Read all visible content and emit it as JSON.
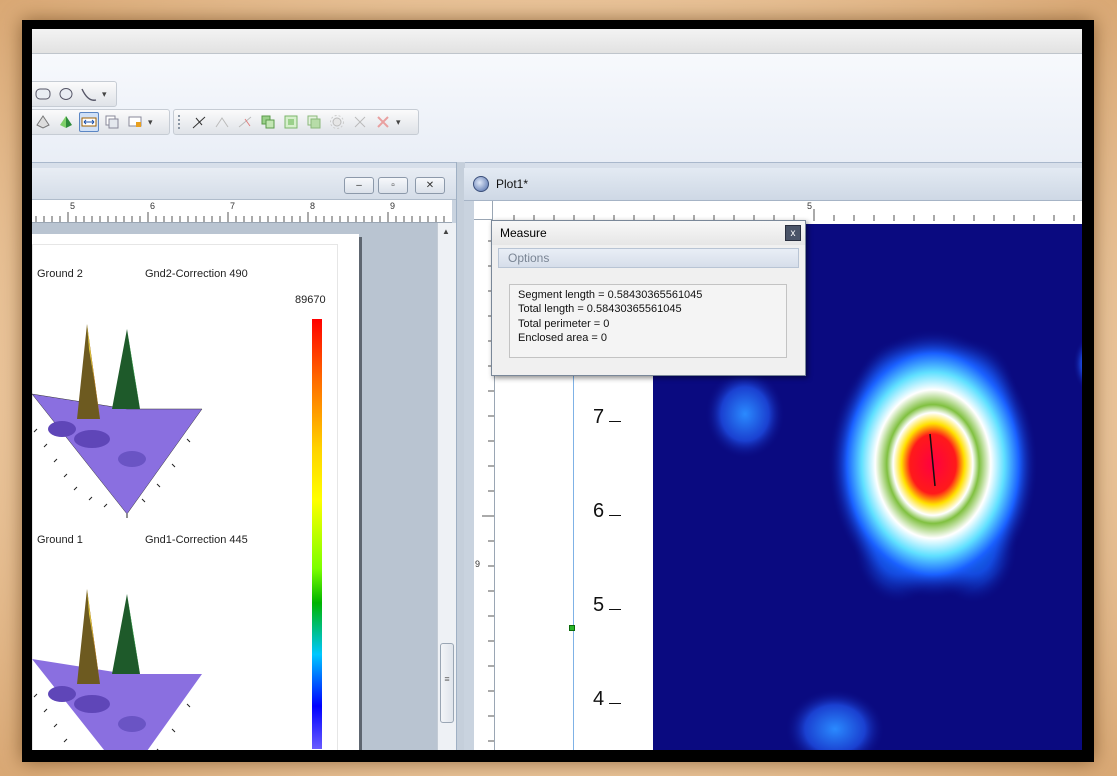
{
  "left_doc": {
    "ruler_numbers": [
      "5",
      "6",
      "7",
      "8",
      "9"
    ],
    "panel1": {
      "label_a": "Ground 2",
      "label_b": "Gnd2-Correction  490"
    },
    "panel2": {
      "label_a": "Ground 1",
      "label_b": "Gnd1-Correction  445"
    },
    "colorbar_max": "89670"
  },
  "plot_window": {
    "title": "Plot1*",
    "ruler_top_number": "5",
    "ruler_left_number": "9",
    "y_ticks": [
      "7",
      "6",
      "5",
      "4"
    ]
  },
  "measure_dialog": {
    "title": "Measure",
    "close_glyph": "x",
    "tab_options": "Options",
    "lines": [
      "Segment length = 0.58430365561045",
      "Total length = 0.58430365561045",
      "Total perimeter = 0",
      "Enclosed area = 0"
    ]
  },
  "window_buttons": {
    "minimize": "–",
    "restore": "▫",
    "close": "✕"
  },
  "colors": {
    "heatmap_bg": "#0a0a80",
    "accent_blue": "#5b86c4"
  },
  "icons": [
    "ellipse-icon",
    "circle-icon",
    "curve-icon",
    "measure-icon",
    "line-icon",
    "close-icon"
  ]
}
